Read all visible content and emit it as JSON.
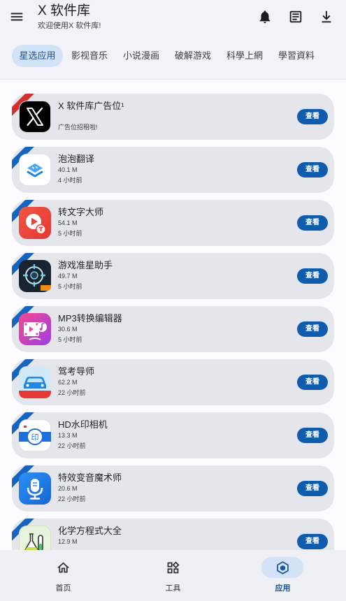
{
  "header": {
    "title": "X 软件库",
    "subtitle": "欢迎使用X 软件库!",
    "icons": [
      "menu-icon",
      "bell-icon",
      "document-icon",
      "download-icon"
    ]
  },
  "tabs": [
    {
      "label": "星选应用",
      "selected": true
    },
    {
      "label": "影视音乐",
      "selected": false
    },
    {
      "label": "小说漫画",
      "selected": false
    },
    {
      "label": "破解游戏",
      "selected": false
    },
    {
      "label": "科學上網",
      "selected": false
    },
    {
      "label": "學習資料",
      "selected": false
    }
  ],
  "apps": [
    {
      "name": "X 软件库广告位¹",
      "note": "广告位招租啦!",
      "icon": "x-logo-icon",
      "ribbon_color": "#d32f2f",
      "action": "查看"
    },
    {
      "name": "泡泡翻译",
      "size": "40.1 M",
      "time": "4 小时前",
      "icon": "bubble-translate-icon",
      "ribbon_color": "#1565c0",
      "action": "查看"
    },
    {
      "name": "转文字大师",
      "size": "54.1 M",
      "time": "5 小时前",
      "icon": "speech-to-text-icon",
      "ribbon_color": "#1565c0",
      "action": "查看"
    },
    {
      "name": "游戏准星助手",
      "size": "49.7 M",
      "time": "5 小时前",
      "icon": "crosshair-icon",
      "ribbon_color": "#1565c0",
      "action": "查看"
    },
    {
      "name": "MP3转换编辑器",
      "size": "30.6 M",
      "time": "5 小时前",
      "icon": "mp3-editor-icon",
      "ribbon_color": "#1565c0",
      "action": "查看"
    },
    {
      "name": "驾考导师",
      "size": "62.2 M",
      "time": "22 小时前",
      "icon": "car-icon",
      "ribbon_color": "#1565c0",
      "action": "查看"
    },
    {
      "name": "HD水印相机",
      "size": "13.3 M",
      "time": "22 小时前",
      "icon": "watermark-camera-icon",
      "icon_text": "印",
      "ribbon_color": "#1565c0",
      "action": "查看"
    },
    {
      "name": "特效变音魔术师",
      "size": "20.6 M",
      "time": "22 小时前",
      "icon": "microphone-icon",
      "ribbon_color": "#1565c0",
      "action": "查看"
    },
    {
      "name": "化学方程式大全",
      "size": "12.9 M",
      "icon": "chemistry-flask-icon",
      "ribbon_color": "#1565c0",
      "action": "查看"
    }
  ],
  "bottom_nav": [
    {
      "label": "首页",
      "icon": "home-icon",
      "selected": false
    },
    {
      "label": "工具",
      "icon": "tools-icon",
      "selected": false
    },
    {
      "label": "应用",
      "icon": "apps-icon",
      "selected": true
    }
  ],
  "colors": {
    "accent": "#0f5cad",
    "selected_pill": "#d2e2f7",
    "card": "#e5e6ec",
    "ad_ribbon": "#d32f2f",
    "ribbon": "#1565c0"
  }
}
